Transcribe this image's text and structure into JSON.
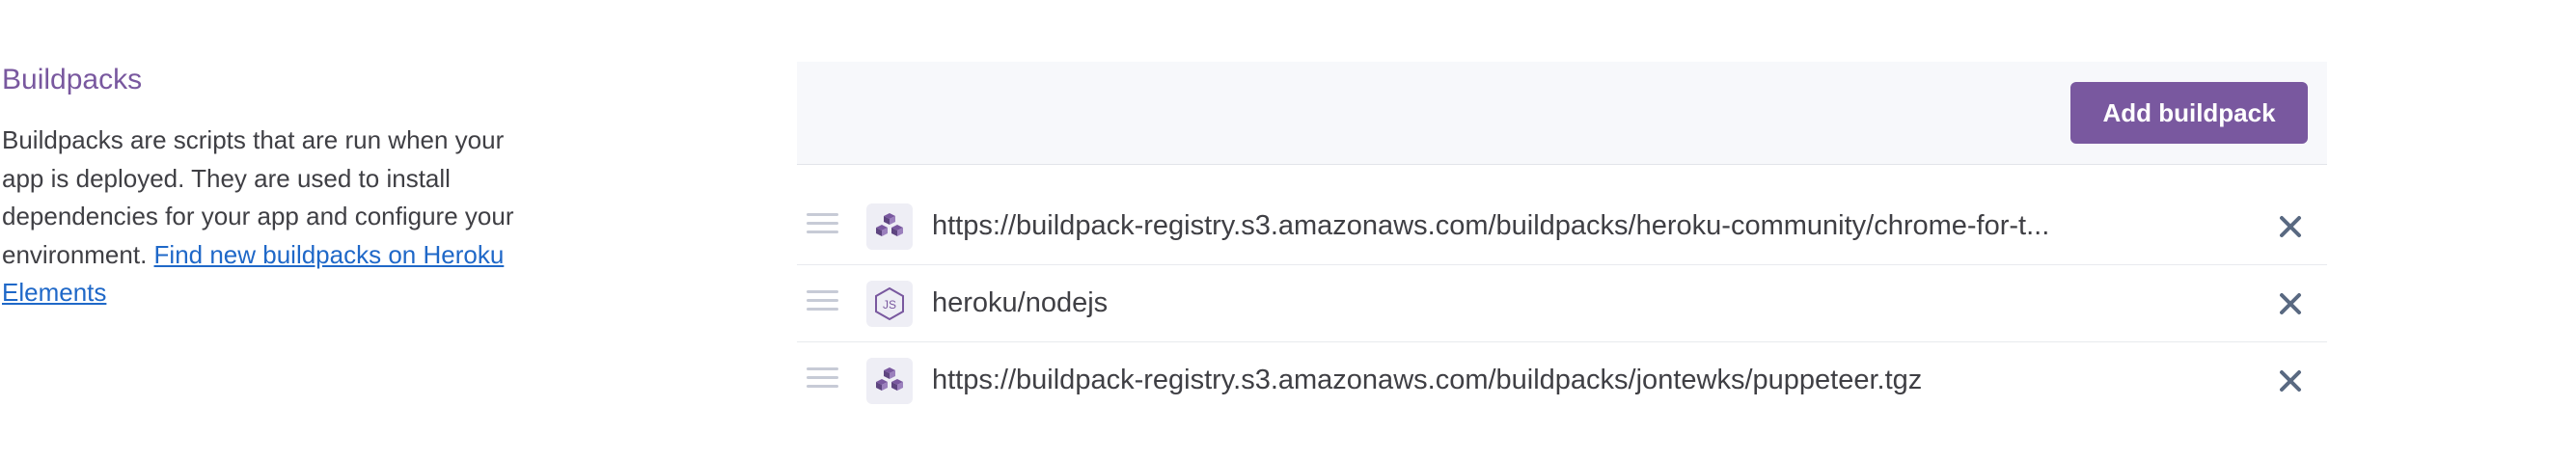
{
  "buildpacks_section": {
    "title": "Buildpacks",
    "description": "Buildpacks are scripts that are run when your app is deployed. They are used to install dependencies for your app and configure your environment. ",
    "link_text": "Find new buildpacks on Heroku Elements",
    "add_button_label": "Add buildpack",
    "items": [
      {
        "icon": "cubes-icon",
        "url": "https://buildpack-registry.s3.amazonaws.com/buildpacks/heroku-community/chrome-for-t..."
      },
      {
        "icon": "nodejs-icon",
        "url": "heroku/nodejs"
      },
      {
        "icon": "cubes-icon",
        "url": "https://buildpack-registry.s3.amazonaws.com/buildpacks/jontewks/puppeteer.tgz"
      }
    ]
  },
  "colors": {
    "accent": "#79589f",
    "link": "#1f68c8",
    "text": "#3f3f44",
    "muted_icon": "#596981"
  }
}
